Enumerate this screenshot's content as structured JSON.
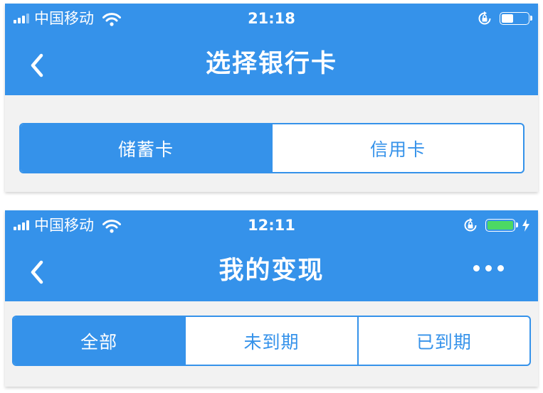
{
  "colors": {
    "primary": "#3592ea",
    "background": "#f2f2f2",
    "battery_green": "#4cd964"
  },
  "screens": [
    {
      "status": {
        "carrier": "中国移动",
        "time": "21:18",
        "icons": [
          "signal-icon",
          "wifi-icon",
          "orientation-lock-icon",
          "battery-icon"
        ],
        "battery_level": 0.45
      },
      "nav": {
        "title": "选择银行卡",
        "back_icon": "chevron-left-icon"
      },
      "segments": [
        {
          "label": "储蓄卡",
          "active": true
        },
        {
          "label": "信用卡",
          "active": false
        }
      ]
    },
    {
      "status": {
        "carrier": "中国移动",
        "time": "12:11",
        "icons": [
          "signal-icon",
          "wifi-icon",
          "orientation-lock-icon",
          "battery-icon",
          "charging-bolt-icon"
        ],
        "battery_level": 1.0,
        "charging": true
      },
      "nav": {
        "title": "我的变现",
        "back_icon": "chevron-left-icon",
        "more_icon": "more-dots-icon"
      },
      "segments": [
        {
          "label": "全部",
          "active": true
        },
        {
          "label": "未到期",
          "active": false
        },
        {
          "label": "已到期",
          "active": false
        }
      ]
    }
  ]
}
